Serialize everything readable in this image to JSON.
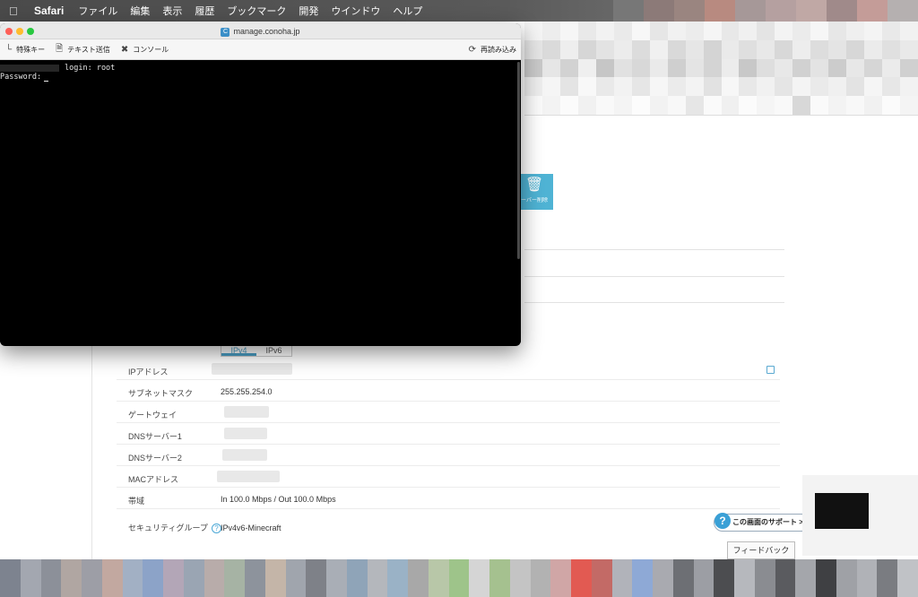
{
  "menubar": {
    "app": "Safari",
    "menus": [
      "ファイル",
      "編集",
      "表示",
      "履歴",
      "ブックマーク",
      "開発",
      "ウインドウ",
      "ヘルプ"
    ]
  },
  "console": {
    "url": "manage.conoha.jp",
    "toolbar": {
      "special_keys": "特殊キー",
      "send_text": "テキスト送信",
      "console": "コンソール",
      "reload": "再読み込み"
    },
    "terminal": {
      "login_line": "login: root",
      "password_line": "Password:"
    }
  },
  "background": {
    "delete_button": "ーバー削除",
    "ip_tabs": [
      "IPv4",
      "IPv6"
    ],
    "rows": [
      {
        "label": "IPアドレス",
        "value": ""
      },
      {
        "label": "サブネットマスク",
        "value": "255.255.254.0"
      },
      {
        "label": "ゲートウェイ",
        "value": ""
      },
      {
        "label": "DNSサーバー1",
        "value": ""
      },
      {
        "label": "DNSサーバー2",
        "value": ""
      },
      {
        "label": "MACアドレス",
        "value": ""
      },
      {
        "label": "帯域",
        "value": "In 100.0 Mbps / Out 100.0 Mbps"
      },
      {
        "label": "セキュリティグループ",
        "value": "IPv4v6-Minecraft"
      }
    ],
    "support_button": "この画面のサポート >",
    "feedback_button": "フィードバック"
  },
  "colors": {
    "accent": "#4fb3d4",
    "terminal_bg": "#000000"
  }
}
